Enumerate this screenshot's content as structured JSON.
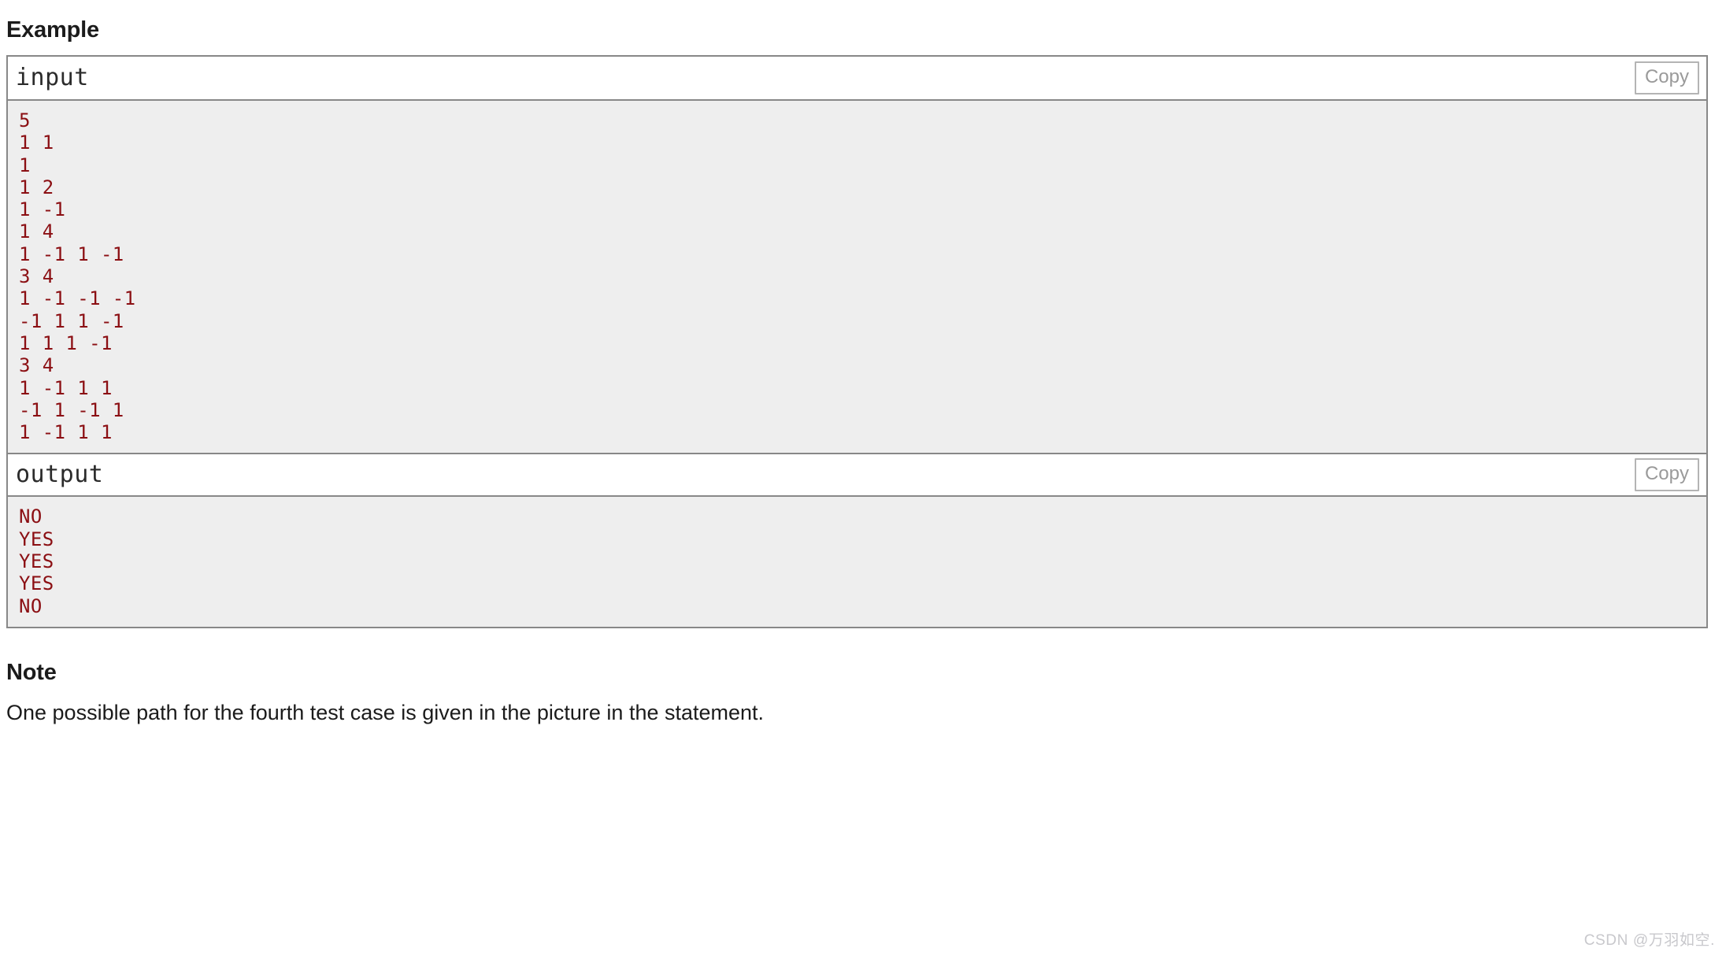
{
  "example": {
    "heading": "Example",
    "blocks": [
      {
        "title": "input",
        "copy_label": "Copy",
        "content": "5\n1 1\n1\n1 2\n1 -1\n1 4\n1 -1 1 -1\n3 4\n1 -1 -1 -1\n-1 1 1 -1\n1 1 1 -1\n3 4\n1 -1 1 1\n-1 1 -1 1\n1 -1 1 1"
      },
      {
        "title": "output",
        "copy_label": "Copy",
        "content": "NO\nYES\nYES\nYES\nNO"
      }
    ]
  },
  "note": {
    "heading": "Note",
    "text": "One possible path for the fourth test case is given in the picture in the statement."
  },
  "watermark": {
    "text": "CSDN @万羽如空."
  },
  "colors": {
    "code_text": "#8b0f13",
    "code_background": "#eeeeee",
    "panel_border": "#888888",
    "copy_border": "#b4b4b4",
    "copy_text": "#9a9a9a",
    "heading_text": "#1b1b1b",
    "watermark_text": "#c8c8cc"
  }
}
